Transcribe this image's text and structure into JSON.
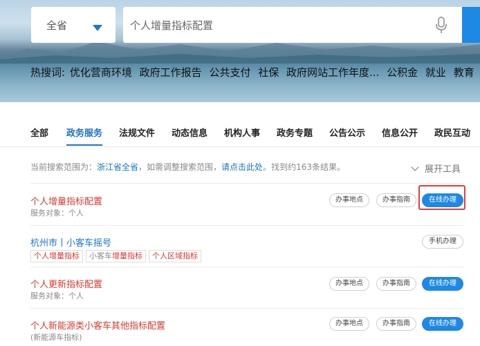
{
  "region_select": {
    "value": "全省"
  },
  "search": {
    "placeholder": "个人增量指标配置"
  },
  "hot": {
    "label": "热搜词:",
    "items": [
      "优化营商环境",
      "政府工作报告",
      "公共支付",
      "社保",
      "政府网站工作年度...",
      "公积金",
      "就业",
      "教育"
    ]
  },
  "tabs": [
    "全部",
    "政务服务",
    "法规文件",
    "动态信息",
    "机构人事",
    "政务专题",
    "公告公示",
    "信息公开",
    "政民互动"
  ],
  "active_tab": "政务服务",
  "info": {
    "prefix": "当前搜索范围为：",
    "scope": "浙江省全省",
    "mid": "，如需调整搜索范围，",
    "link": "请点击此处",
    "suffix": "。找到约163条结果。"
  },
  "expand_label": "展开工具",
  "results": [
    {
      "title": "个人增量指标配置",
      "sub": "服务对象：个人",
      "buttons": [
        "办事地点",
        "办事指南",
        "在线办理"
      ]
    },
    {
      "title": "杭州市丨小客车摇号",
      "tags": [
        {
          "a": "",
          "b": "个人增量指标"
        },
        {
          "a": "小客车",
          "b": "增量指标"
        },
        {
          "a": "",
          "b": "个人区域指标"
        }
      ],
      "buttons": [
        "手机办理"
      ]
    },
    {
      "title": "个人更新指标配置",
      "sub": "服务对象：个人",
      "buttons": [
        "办事地点",
        "办事指南",
        "在线办理"
      ]
    },
    {
      "title": "个人新能源类小客车其他指标配置",
      "sub": "(新能源车指标)",
      "buttons": [
        "办事地点",
        "办事指南",
        "在线办理"
      ]
    }
  ],
  "colors": {
    "accent": "#1a73c9",
    "button": "#1e88e5",
    "title_red": "#d63a2f",
    "highlight_box": "#e53935"
  }
}
